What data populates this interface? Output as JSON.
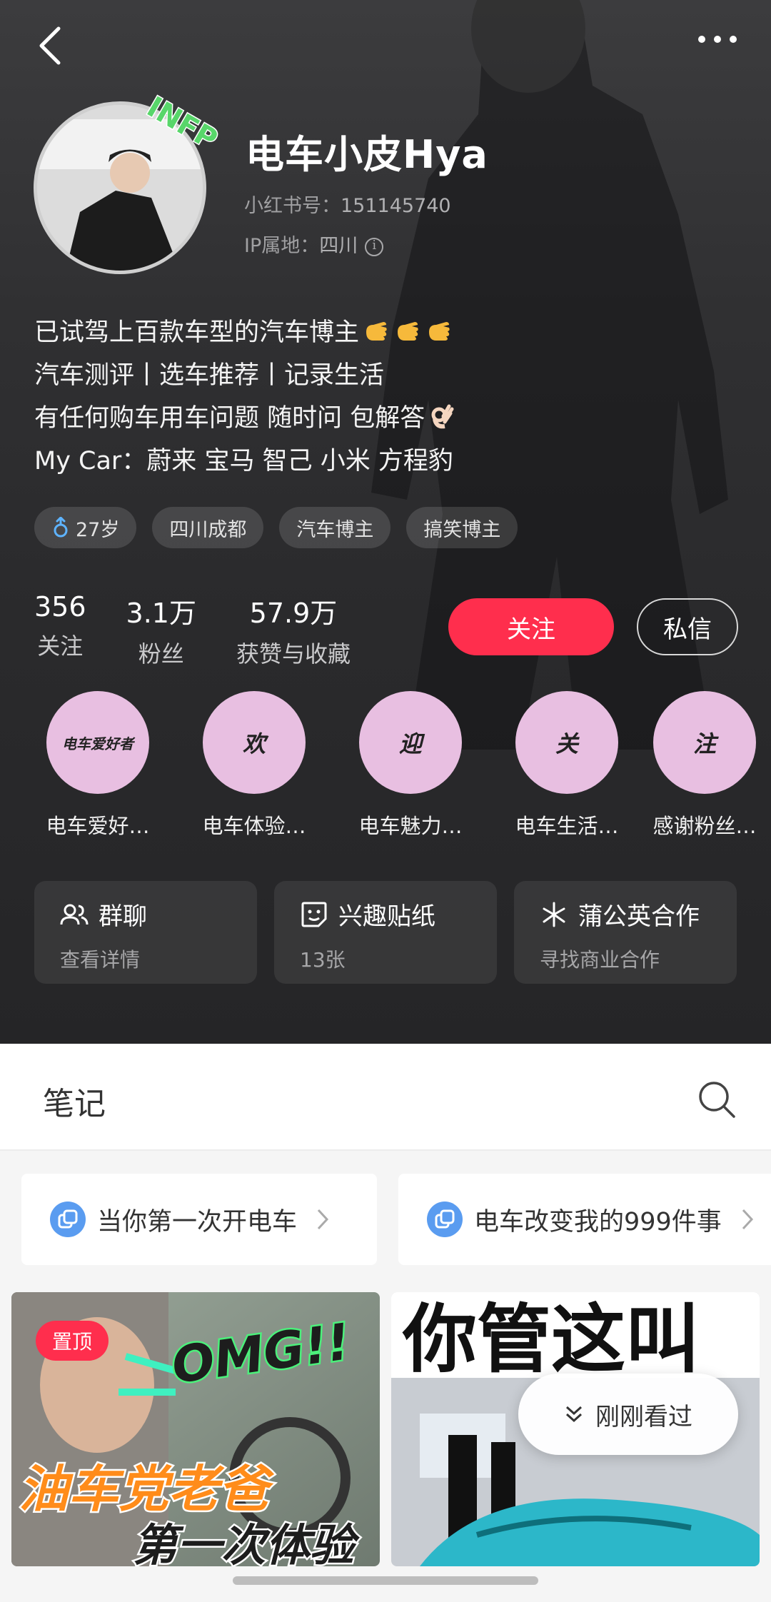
{
  "profile": {
    "nickname": "电车小皮Hya",
    "id_label": "小红书号：",
    "id_value": "151145740",
    "ip_label": "IP属地：",
    "ip_value": "四川",
    "mbti_badge": "INFP",
    "bio": [
      "已试驾上百款车型的汽车博主",
      "汽车测评丨选车推荐丨记录生活",
      "有任何购车用车问题 随时问 包解答",
      "My Car：蔚来 宝马 智己 小米 方程豹"
    ],
    "tags": [
      "27岁",
      "四川成都",
      "汽车博主",
      "搞笑博主"
    ]
  },
  "stats": [
    {
      "value": "356",
      "label": "关注"
    },
    {
      "value": "3.1万",
      "label": "粉丝"
    },
    {
      "value": "57.9万",
      "label": "获赞与收藏"
    }
  ],
  "actions": {
    "follow": "关注",
    "message": "私信"
  },
  "groups": [
    {
      "badge": "电车爱好者",
      "label": "电车爱好…"
    },
    {
      "badge": "欢",
      "label": "电车体验…"
    },
    {
      "badge": "迎",
      "label": "电车魅力…"
    },
    {
      "badge": "关",
      "label": "电车生活…"
    },
    {
      "badge": "注",
      "label": "感谢粉丝…"
    }
  ],
  "cards": [
    {
      "icon": "group-chat-icon",
      "title": "群聊",
      "sub": "查看详情"
    },
    {
      "icon": "sticker-icon",
      "title": "兴趣贴纸",
      "sub": "13张"
    },
    {
      "icon": "dandelion-icon",
      "title": "蒲公英合作",
      "sub": "寻找商业合作"
    }
  ],
  "notes": {
    "title": "笔记",
    "collections": [
      "当你第一次开电车",
      "电车改变我的999件事"
    ],
    "pinned_label": "置顶",
    "thumb1_overlay": "OMG!!",
    "thumb1_caption_1": "油车党老爸",
    "thumb1_caption_2": "第一次体验",
    "thumb2_caption": "你管这叫",
    "recent_button": "刚刚看过"
  },
  "colors": {
    "accent": "#ff2e4d",
    "group_circle": "#e8bfe1",
    "hero_bg": "#2e2e30"
  }
}
